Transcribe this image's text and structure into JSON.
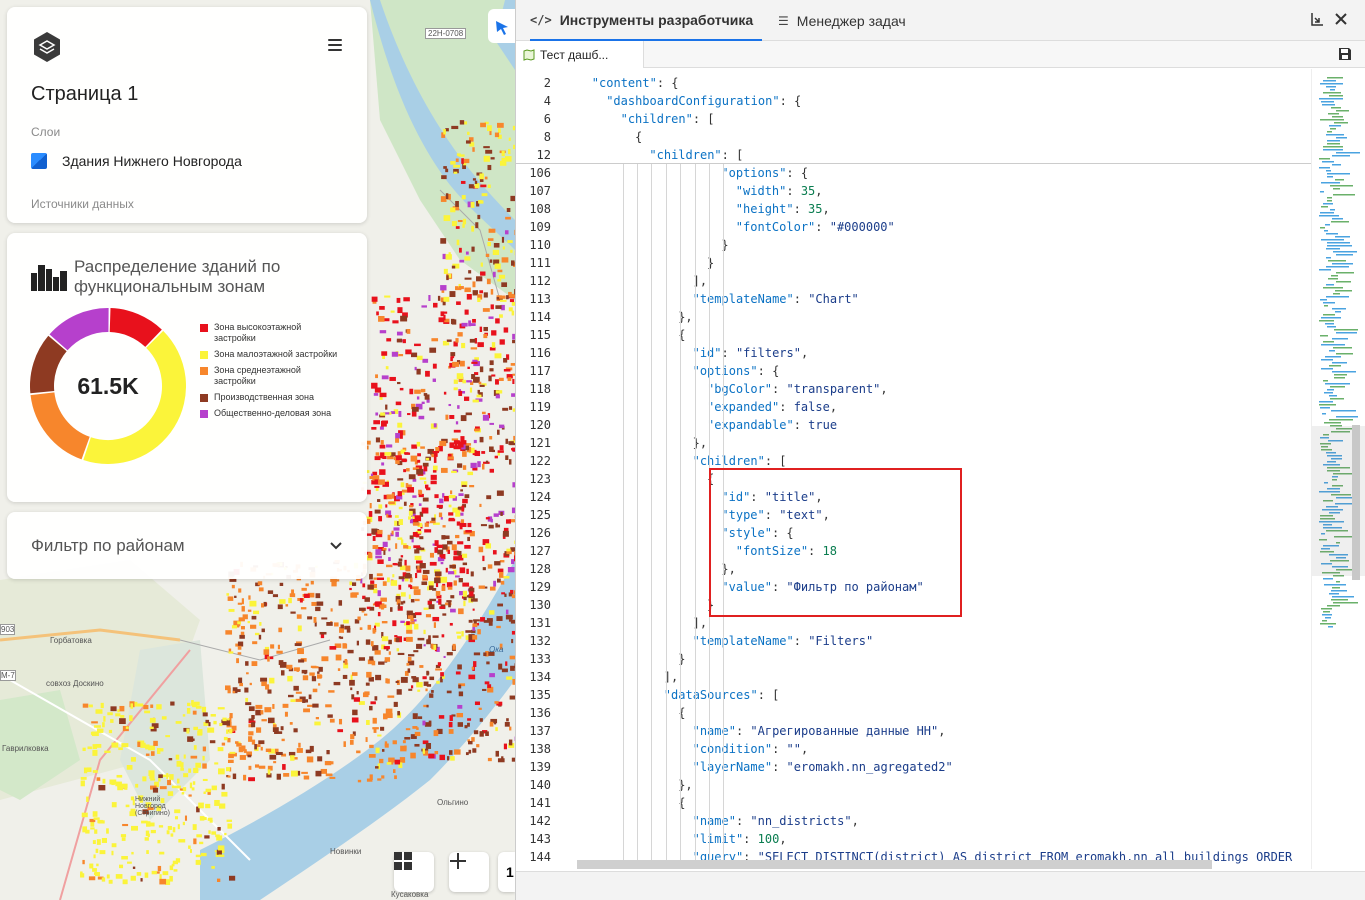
{
  "map": {
    "road_label": "22Н-0708",
    "places": [
      "Горбатовка",
      "совхоз Доскино",
      "Гаврилковка",
      "Нижний Новгород (Стригино)",
      "Ольгино",
      "Новинки",
      "Кусаковка",
      "Ока",
      "М-7",
      "903"
    ]
  },
  "page_panel": {
    "title": "Страница 1",
    "layers_label": "Слои",
    "layer_name": "Здания Нижнего Новгорода",
    "sources_label": "Источники данных"
  },
  "chart_panel": {
    "title": "Распределение зданий по функциональным зонам",
    "center_value": "61.5K"
  },
  "chart_data": {
    "type": "pie",
    "categories": [
      "Зона высокоэтажной застройки",
      "Зона малоэтажной застройки",
      "Зона среднеэтажной застройки",
      "Производственная зона",
      "Общественно-деловая зона"
    ],
    "values": [
      12,
      43,
      18,
      13,
      14
    ],
    "colors": [
      "#e8111c",
      "#fbf43a",
      "#f7862c",
      "#8e3a22",
      "#b640cc"
    ]
  },
  "filter_panel": {
    "title": "Фильтр по районам"
  },
  "map_controls": {
    "zoom_label": "1"
  },
  "devtools": {
    "tab_dev": "Инструменты разработчика",
    "tab_tasks": "Менеджер задач",
    "file_tab": "Тест дашб...",
    "sticky_lines": [
      {
        "ln": "2",
        "ind": 4,
        "html": "<span class=\"k\">\"content\"</span><span class=\"p\">: {</span>"
      },
      {
        "ln": "4",
        "ind": 6,
        "html": "<span class=\"k\">\"dashboardConfiguration\"</span><span class=\"p\">: {</span>"
      },
      {
        "ln": "6",
        "ind": 8,
        "html": "<span class=\"k\">\"children\"</span><span class=\"p\">: [</span>"
      },
      {
        "ln": "8",
        "ind": 10,
        "html": "<span class=\"p\">{</span>"
      },
      {
        "ln": "12",
        "ind": 12,
        "html": "<span class=\"k\">\"children\"</span><span class=\"p\">: [</span>"
      }
    ],
    "lines": [
      {
        "ln": "106",
        "ind": 22,
        "html": "<span class=\"k\">\"options\"</span><span class=\"p\">: {</span>"
      },
      {
        "ln": "107",
        "ind": 24,
        "html": "<span class=\"k\">\"width\"</span><span class=\"p\">: </span><span class=\"n\">35</span><span class=\"p\">,</span>"
      },
      {
        "ln": "108",
        "ind": 24,
        "html": "<span class=\"k\">\"height\"</span><span class=\"p\">: </span><span class=\"n\">35</span><span class=\"p\">,</span>"
      },
      {
        "ln": "109",
        "ind": 24,
        "html": "<span class=\"k\">\"fontColor\"</span><span class=\"p\">: </span><span class=\"s\">\"#000000\"</span>"
      },
      {
        "ln": "110",
        "ind": 22,
        "html": "<span class=\"p\">}</span>"
      },
      {
        "ln": "111",
        "ind": 20,
        "html": "<span class=\"p\">}</span>"
      },
      {
        "ln": "112",
        "ind": 18,
        "html": "<span class=\"p\">],</span>"
      },
      {
        "ln": "113",
        "ind": 18,
        "html": "<span class=\"k\">\"templateName\"</span><span class=\"p\">: </span><span class=\"s\">\"Chart\"</span>"
      },
      {
        "ln": "114",
        "ind": 16,
        "html": "<span class=\"p\">},</span>"
      },
      {
        "ln": "115",
        "ind": 16,
        "html": "<span class=\"p\">{</span>"
      },
      {
        "ln": "116",
        "ind": 18,
        "html": "<span class=\"k\">\"id\"</span><span class=\"p\">: </span><span class=\"s\">\"filters\"</span><span class=\"p\">,</span>"
      },
      {
        "ln": "117",
        "ind": 18,
        "html": "<span class=\"k\">\"options\"</span><span class=\"p\">: {</span>"
      },
      {
        "ln": "118",
        "ind": 20,
        "html": "<span class=\"k\">\"bgColor\"</span><span class=\"p\">: </span><span class=\"s\">\"transparent\"</span><span class=\"p\">,</span>"
      },
      {
        "ln": "119",
        "ind": 20,
        "html": "<span class=\"k\">\"expanded\"</span><span class=\"p\">: </span><span class=\"s\">false</span><span class=\"p\">,</span>"
      },
      {
        "ln": "120",
        "ind": 20,
        "html": "<span class=\"k\">\"expandable\"</span><span class=\"p\">: </span><span class=\"s\">true</span>"
      },
      {
        "ln": "121",
        "ind": 18,
        "html": "<span class=\"p\">},</span>"
      },
      {
        "ln": "122",
        "ind": 18,
        "html": "<span class=\"k\">\"children\"</span><span class=\"p\">: [</span>"
      },
      {
        "ln": "123",
        "ind": 20,
        "html": "<span class=\"p\">{</span>"
      },
      {
        "ln": "124",
        "ind": 22,
        "html": "<span class=\"k\">\"id\"</span><span class=\"p\">: </span><span class=\"s\">\"title\"</span><span class=\"p\">,</span>"
      },
      {
        "ln": "125",
        "ind": 22,
        "html": "<span class=\"k\">\"type\"</span><span class=\"p\">: </span><span class=\"s\">\"text\"</span><span class=\"p\">,</span>"
      },
      {
        "ln": "126",
        "ind": 22,
        "html": "<span class=\"k\">\"style\"</span><span class=\"p\">: {</span>"
      },
      {
        "ln": "127",
        "ind": 24,
        "html": "<span class=\"k\">\"fontSize\"</span><span class=\"p\">: </span><span class=\"n\">18</span>"
      },
      {
        "ln": "128",
        "ind": 22,
        "html": "<span class=\"p\">},</span>"
      },
      {
        "ln": "129",
        "ind": 22,
        "html": "<span class=\"k\">\"value\"</span><span class=\"p\">: </span><span class=\"s\">\"Фильтр по районам\"</span>"
      },
      {
        "ln": "130",
        "ind": 20,
        "html": "<span class=\"p\">}</span>"
      },
      {
        "ln": "131",
        "ind": 18,
        "html": "<span class=\"p\">],</span>"
      },
      {
        "ln": "132",
        "ind": 18,
        "html": "<span class=\"k\">\"templateName\"</span><span class=\"p\">: </span><span class=\"s\">\"Filters\"</span>"
      },
      {
        "ln": "133",
        "ind": 16,
        "html": "<span class=\"p\">}</span>"
      },
      {
        "ln": "134",
        "ind": 14,
        "html": "<span class=\"p\">],</span>"
      },
      {
        "ln": "135",
        "ind": 14,
        "html": "<span class=\"k\">\"dataSources\"</span><span class=\"p\">: [</span>"
      },
      {
        "ln": "136",
        "ind": 16,
        "html": "<span class=\"p\">{</span>"
      },
      {
        "ln": "137",
        "ind": 18,
        "html": "<span class=\"k\">\"name\"</span><span class=\"p\">: </span><span class=\"s\">\"Агрегированные данные НН\"</span><span class=\"p\">,</span>"
      },
      {
        "ln": "138",
        "ind": 18,
        "html": "<span class=\"k\">\"condition\"</span><span class=\"p\">: </span><span class=\"s\">\"\"</span><span class=\"p\">,</span>"
      },
      {
        "ln": "139",
        "ind": 18,
        "html": "<span class=\"k\">\"layerName\"</span><span class=\"p\">: </span><span class=\"s\">\"eromakh.nn_agregated2\"</span>"
      },
      {
        "ln": "140",
        "ind": 16,
        "html": "<span class=\"p\">},</span>"
      },
      {
        "ln": "141",
        "ind": 16,
        "html": "<span class=\"p\">{</span>"
      },
      {
        "ln": "142",
        "ind": 18,
        "html": "<span class=\"k\">\"name\"</span><span class=\"p\">: </span><span class=\"s\">\"nn_districts\"</span><span class=\"p\">,</span>"
      },
      {
        "ln": "143",
        "ind": 18,
        "html": "<span class=\"k\">\"limit\"</span><span class=\"p\">: </span><span class=\"n\">100</span><span class=\"p\">,</span>"
      },
      {
        "ln": "144",
        "ind": 18,
        "html": "<span class=\"k\">\"query\"</span><span class=\"p\">: </span><span class=\"s\">\"SELECT DISTINCT(district) AS district FROM eromakh.nn_all_buildings ORDER</span>"
      }
    ]
  }
}
